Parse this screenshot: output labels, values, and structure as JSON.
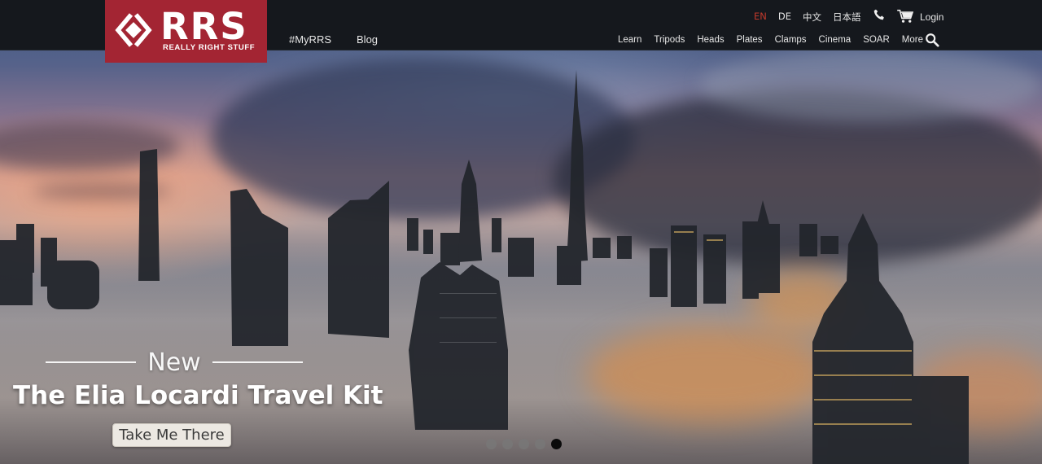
{
  "brand": {
    "wordmark": "RRS",
    "tagline": "REALLY RIGHT STUFF",
    "color": "#a32533"
  },
  "nav_primary": [
    {
      "label": "#MyRRS"
    },
    {
      "label": "Blog"
    }
  ],
  "languages": [
    {
      "label": "EN",
      "active": true
    },
    {
      "label": "DE",
      "active": false
    },
    {
      "label": "中文",
      "active": false
    },
    {
      "label": "日本語",
      "active": false
    }
  ],
  "utility": {
    "phone_icon": "phone-icon",
    "cart_icon": "cart-icon",
    "login_label": "Login",
    "search_icon": "search-icon"
  },
  "nav_products": [
    {
      "label": "Learn"
    },
    {
      "label": "Tripods"
    },
    {
      "label": "Heads"
    },
    {
      "label": "Plates"
    },
    {
      "label": "Clamps"
    },
    {
      "label": "Cinema"
    },
    {
      "label": "SOAR"
    },
    {
      "label": "More"
    }
  ],
  "hero": {
    "kicker": "New",
    "title": "The Elia Locardi Travel Kit",
    "cta_label": "Take Me There",
    "slides": 5,
    "active_slide": 5
  },
  "colors": {
    "header_bg": "#15181d",
    "active_lang": "#c0392b"
  }
}
